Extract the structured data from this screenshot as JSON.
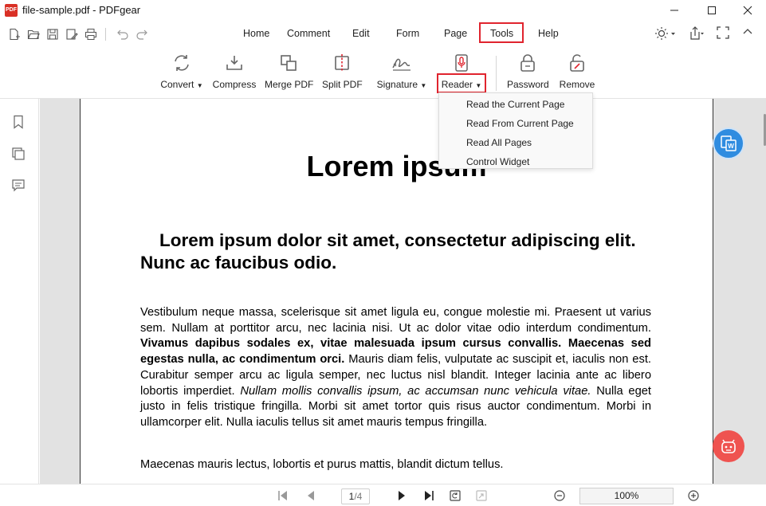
{
  "window": {
    "title": "file-sample.pdf - PDFgear",
    "logo_text": "PDF"
  },
  "menu": {
    "items": [
      "Home",
      "Comment",
      "Edit",
      "Form",
      "Page",
      "Tools",
      "Help"
    ],
    "active": "Tools"
  },
  "ribbon": {
    "convert": "Convert",
    "compress": "Compress",
    "merge": "Merge PDF",
    "split": "Split PDF",
    "signature": "Signature",
    "reader": "Reader",
    "password": "Password",
    "remove": "Remove"
  },
  "reader_menu": {
    "items": [
      "Read the Current Page",
      "Read From Current Page",
      "Read All Pages",
      "Control Widget"
    ]
  },
  "document": {
    "heading1": "Lorem ipsum",
    "heading2": "Lorem ipsum dolor sit amet, consectetur adipiscing elit. Nunc ac faucibus odio.",
    "p1_a": "Vestibulum neque massa, scelerisque sit amet ligula eu, congue molestie mi. Praesent ut varius sem. Nullam at porttitor arcu, nec lacinia nisi. Ut ac dolor vitae odio interdum condimentum. ",
    "p1_bold": "Vivamus dapibus sodales ex, vitae malesuada ipsum cursus convallis. Maecenas sed egestas nulla, ac condimentum orci.",
    "p1_b": " Mauris diam felis, vulputate ac suscipit et, iaculis non est. Curabitur semper arcu ac ligula semper, nec luctus nisl blandit. Integer lacinia ante ac libero lobortis imperdiet. ",
    "p1_italic": "Nullam mollis convallis ipsum, ac accumsan nunc vehicula vitae.",
    "p1_c": " Nulla eget justo in felis tristique fringilla. Morbi sit amet tortor quis risus auctor condimentum. Morbi in ullamcorper elit. Nulla iaculis tellus sit amet mauris tempus fringilla.",
    "p2": "Maecenas mauris lectus, lobortis et purus mattis, blandit dictum tellus."
  },
  "status": {
    "current_page": "1",
    "total_pages": "/4",
    "zoom": "100%"
  },
  "colors": {
    "highlight": "#e0242e",
    "accent_blue": "#2f8ce0",
    "accent_red": "#ef5350"
  }
}
